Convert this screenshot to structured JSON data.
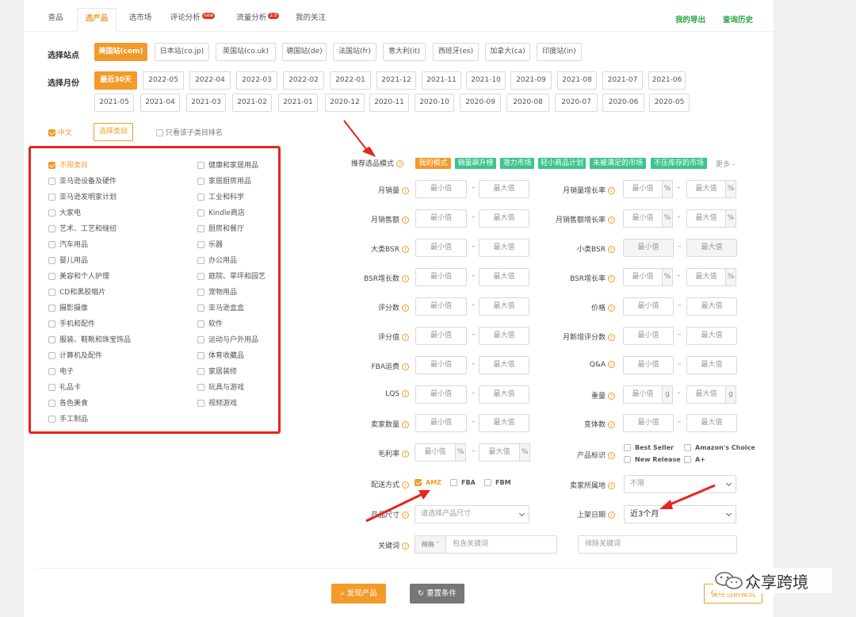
{
  "tabs": [
    {
      "label": "查品",
      "active": false
    },
    {
      "label": "选产品",
      "active": true
    },
    {
      "label": "选市场",
      "active": false
    },
    {
      "label": "评论分析",
      "active": false,
      "badge": "new"
    },
    {
      "label": "流量分析",
      "active": false,
      "badge": "2.0"
    },
    {
      "label": "我的关注",
      "active": false
    }
  ],
  "header_links": {
    "export": "我的导出",
    "history": "查询历史"
  },
  "site_label": "选择站点",
  "sites": [
    "美国站(com)",
    "日本站(co.jp)",
    "英国站(co.uk)",
    "德国站(de)",
    "法国站(fr)",
    "意大利(it)",
    "西班牙(es)",
    "加拿大(ca)",
    "印度站(in)"
  ],
  "month_label": "选择月份",
  "months_row1": [
    "最近30天",
    "2022-05",
    "2022-04",
    "2022-03",
    "2022-02",
    "2022-01",
    "2021-12",
    "2021-11",
    "2021-10",
    "2021-09",
    "2021-08",
    "2021-07",
    "2021-06"
  ],
  "months_row2": [
    "2021-05",
    "2021-04",
    "2021-03",
    "2021-02",
    "2021-01",
    "2020-12",
    "2020-11",
    "2020-10",
    "2020-09",
    "2020-08",
    "2020-07",
    "2020-06",
    "2020-05"
  ],
  "lang": "中文",
  "select_category": "选择类目",
  "sub_only": "只看该子类目排名",
  "categories_left": [
    "不限类目",
    "亚马逊设备及硬件",
    "亚马逊发明家计划",
    "大家电",
    "艺术、工艺和缝纫",
    "汽车用品",
    "婴儿用品",
    "美容和个人护理",
    "CD和黑胶唱片",
    "摄影摄像",
    "手机和配件",
    "服装、鞋靴和珠宝饰品",
    "计算机及配件",
    "电子",
    "礼品卡",
    "各色美食",
    "手工制品"
  ],
  "categories_right": [
    "健康和家居用品",
    "家居厨房用品",
    "工业和科学",
    "Kindle商店",
    "厨房和餐厅",
    "乐器",
    "办公用品",
    "庭院、草坪和园艺",
    "宠物用品",
    "亚马逊盒盒",
    "软件",
    "运动与户外用品",
    "体育收藏品",
    "家居装修",
    "玩具与游戏",
    "视频游戏"
  ],
  "mode_label": "推荐选品模式",
  "modes": [
    "我的模式",
    "销量飙升榜",
    "潜力市场",
    "轻小商品计划",
    "未被满足的市场",
    "不压库存的市场"
  ],
  "more": "更多",
  "min_ph": "最小值",
  "max_ph": "最大值",
  "left_filters": [
    "月销量",
    "月销售额",
    "大类BSR",
    "BSR增长数",
    "评分数",
    "评分值",
    "FBA运费",
    "LQS",
    "卖家数量"
  ],
  "right_filters": [
    "月销量增长率",
    "月销售额增长率",
    "小类BSR",
    "BSR增长率",
    "价格",
    "月新增评分数",
    "Q&A",
    "重量",
    "变体数"
  ],
  "pct": "%",
  "g": "g",
  "margin_label": "毛利率",
  "tag_label": "产品标识",
  "tags": [
    "Best Seller",
    "Amazon's Choice",
    "New Release",
    "A+"
  ],
  "ship_label": "配送方式",
  "ships": [
    "AMZ",
    "FBA",
    "FBM"
  ],
  "seller_loc_label": "卖家所属地",
  "seller_loc_value": "不限",
  "size_label": "产品尺寸",
  "size_ph": "请选择产品尺寸",
  "date_label": "上架日期",
  "date_value": "近3个月",
  "kw_label": "关键词",
  "kw_mode": "精确",
  "kw_include_ph": "包含关键词",
  "kw_exclude_ph": "排除关键词",
  "find_btn": "发现产品",
  "reset_btn": "重置条件",
  "save_btn": "保存当前模式",
  "watermark": "众享跨境",
  "colors": {
    "accent": "#f39a2a",
    "green": "#3cc48c",
    "red": "#e3261e"
  }
}
